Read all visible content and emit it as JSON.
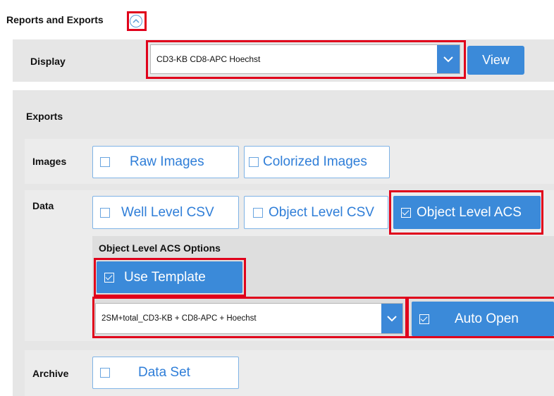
{
  "section": {
    "title": "Reports and Exports"
  },
  "display": {
    "label": "Display",
    "selected": "CD3-KB CD8-APC Hoechst",
    "view_label": "View"
  },
  "exports": {
    "title": "Exports",
    "images": {
      "label": "Images",
      "raw": "Raw Images",
      "colorized": "Colorized Images"
    },
    "data": {
      "label": "Data",
      "well_csv": "Well Level CSV",
      "object_csv": "Object Level CSV",
      "object_acs": "Object Level ACS"
    },
    "acs_options": {
      "title": "Object Level ACS Options",
      "use_template": "Use Template",
      "template_selected": "2SM+total_CD3-KB + CD8-APC + Hoechst",
      "auto_open": "Auto Open"
    },
    "archive": {
      "label": "Archive",
      "data_set": "Data Set"
    }
  },
  "colors": {
    "accent": "#3b8ad9",
    "highlight": "#e0001b",
    "panel": "#e6e6e6"
  }
}
